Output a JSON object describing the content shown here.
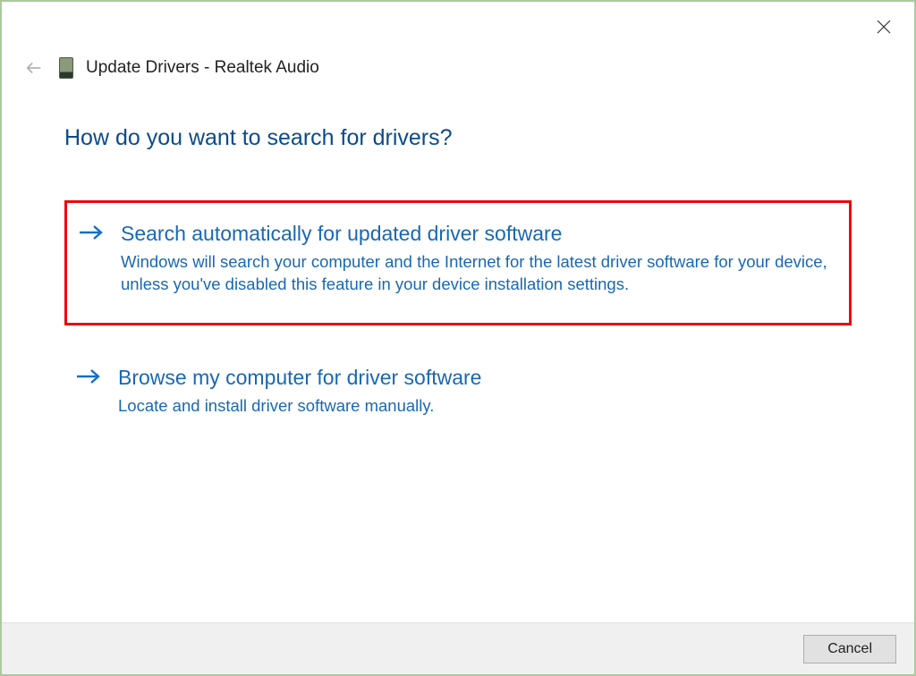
{
  "window": {
    "title": "Update Drivers - Realtek Audio"
  },
  "content": {
    "heading": "How do you want to search for drivers?"
  },
  "options": {
    "auto": {
      "title": "Search automatically for updated driver software",
      "description": "Windows will search your computer and the Internet for the latest driver software for your device, unless you've disabled this feature in your device installation settings."
    },
    "browse": {
      "title": "Browse my computer for driver software",
      "description": "Locate and install driver software manually."
    }
  },
  "footer": {
    "cancel_label": "Cancel"
  }
}
